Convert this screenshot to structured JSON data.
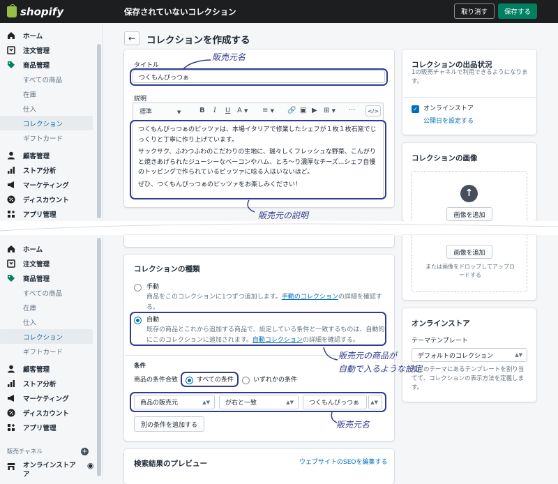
{
  "topbar": {
    "brand": "shopify",
    "title": "保存されていないコレクション",
    "discard_label": "取り消す",
    "save_label": "保存する"
  },
  "sidebar": {
    "home": "ホーム",
    "orders": "注文管理",
    "products": "商品管理",
    "products_sub": [
      "すべての商品",
      "在庫",
      "仕入",
      "コレクション",
      "ギフトカード"
    ],
    "customers": "顧客管理",
    "analytics": "ストア分析",
    "marketing": "マーケティング",
    "discounts": "ディスカウント",
    "apps": "アプリ管理",
    "sales_channels": "販売チャネル",
    "online_store": "オンラインストア",
    "online_store_wrap": "ア"
  },
  "page": {
    "title": "コレクションを作成する"
  },
  "title_card": {
    "title_label": "タイトル",
    "title_value": "つくもんぴっつぁ",
    "desc_label": "説明",
    "format_value": "標準",
    "description_paragraphs": [
      "つくもんぴっつぁのピッツァは、本場イタリアで修業したシェフが１枚１枚石窯でじっくりと丁寧に作り上げています。",
      "サックサク、ふわつふわのこだわりの生地に、瑞々しくフレッシュな野菜、こんがりと焼きあげられたジューシーなベーコンやハム、とろ～り濃厚なチーズ...シェフ自慢のトッピングで作られているピッツァに唸る人はいないほど。",
      "ぜひ、つくもんぴっつぁのピッツァをお楽しみください！"
    ]
  },
  "availability_card": {
    "title": "コレクションの出品状況",
    "subtitle": "1の販売チャネルで利用できるようになります。",
    "channel": "オンラインストア",
    "schedule_link": "公開日を設定する"
  },
  "image_card": {
    "title": "コレクションの画像",
    "add_button": "画像を追加",
    "drop_text": "または画像をドロップしてアップロードする"
  },
  "type_card": {
    "title": "コレクションの種類",
    "manual_label": "手動",
    "manual_desc_1": "商品をこのコレクションに1つずつ追加します。",
    "manual_link": "手動のコレクション",
    "manual_desc_2": "の詳細を確認する。",
    "auto_label": "自動",
    "auto_desc_1": "既存の商品とこれから追加する商品で、設定している条件と一致するものは、自動的にこのコレクションに追加されます。",
    "auto_link": "自動コレクション",
    "auto_desc_2": "の詳細を確認する。",
    "conditions_heading": "条件",
    "match_label": "商品の条件合致",
    "match_all": "すべての条件",
    "match_any": "いずれかの条件",
    "condition_field": "商品の販売元",
    "condition_op": "が右と一致",
    "condition_value": "つくもんぴっつぁ",
    "add_condition": "別の条件を追加する"
  },
  "online_store_card": {
    "title": "オンラインストア",
    "template_label": "テーマテンプレート",
    "template_value": "デフォルトのコレクション",
    "template_help": "現在のテーマにあるテンプレートを割り当てて、コレクションの表示方法を定義します。"
  },
  "seo_card": {
    "title": "検索結果のプレビュー",
    "edit_link": "ウェブサイトのSEOを編集する"
  },
  "annotations": {
    "vendor_name_1": "販売元名",
    "vendor_desc": "販売元の説明",
    "auto_setting_1": "販売元の商品が",
    "auto_setting_2": "自動で入るような設定",
    "vendor_name_2": "販売元名"
  },
  "colors": {
    "topbar": "#1c1e20",
    "save": "#008060",
    "annotation": "#2f3a8f",
    "link": "#006fbb"
  }
}
